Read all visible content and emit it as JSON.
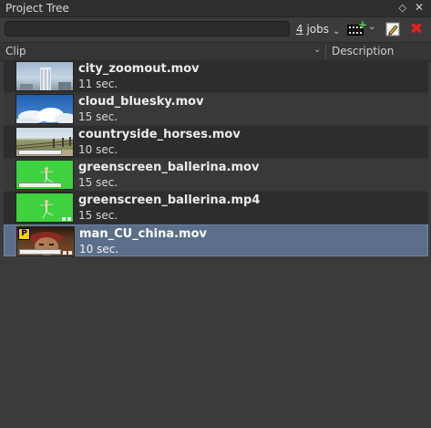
{
  "panel": {
    "title": "Project Tree",
    "float_glyph": "◇",
    "close_glyph": "✕"
  },
  "toolbar": {
    "search_placeholder": "",
    "jobs_count": "4",
    "jobs_label": " jobs",
    "chevron": "⌄",
    "add_media_plus": "+",
    "delete_glyph": "✖"
  },
  "header": {
    "clip": "Clip",
    "description": "Description",
    "chevron": "⌄"
  },
  "clips": [
    {
      "name": "city_zoomout.mov",
      "duration": "11 sec.",
      "thumb": "city"
    },
    {
      "name": "cloud_bluesky.mov",
      "duration": "15 sec.",
      "thumb": "sky"
    },
    {
      "name": "countryside_horses.mov",
      "duration": "10 sec.",
      "thumb": "field"
    },
    {
      "name": "greenscreen_ballerina.mov",
      "duration": "15 sec.",
      "thumb": "green"
    },
    {
      "name": "greenscreen_ballerina.mp4",
      "duration": "15 sec.",
      "thumb": "green"
    },
    {
      "name": "man_CU_china.mov",
      "duration": "10 sec.",
      "thumb": "man",
      "badge": "P",
      "selected": true
    }
  ],
  "colors": {
    "selection": "#5b6f8a",
    "delete_red": "#e02020",
    "badge_yellow": "#f5d400"
  }
}
